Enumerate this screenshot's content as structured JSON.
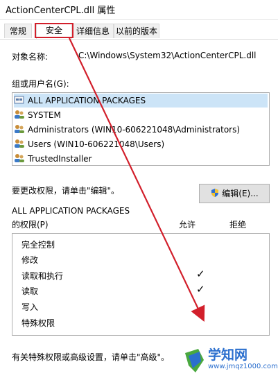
{
  "window": {
    "title": "ActionCenterCPL.dll 属性"
  },
  "tabs": [
    {
      "label": "常规"
    },
    {
      "label": "安全"
    },
    {
      "label": "详细信息"
    },
    {
      "label": "以前的版本"
    }
  ],
  "security": {
    "object_label": "对象名称:",
    "object_value": "C:\\Windows\\System32\\ActionCenterCPL.dll",
    "group_label": "组或用户名(G):",
    "users": [
      "ALL APPLICATION PACKAGES",
      "SYSTEM",
      "Administrators (WIN10-606221048\\Administrators)",
      "Users (WIN10-606221048\\Users)",
      "TrustedInstaller"
    ],
    "change_hint": "要更改权限，请单击\"编辑\"。",
    "edit_button": "编辑(E)...",
    "perm_for_line1": "ALL APPLICATION PACKAGES",
    "perm_for_line2": "的权限(P)",
    "allow_header": "允许",
    "deny_header": "拒绝",
    "permissions": [
      {
        "name": "完全控制",
        "allow": false
      },
      {
        "name": "修改",
        "allow": false
      },
      {
        "name": "读取和执行",
        "allow": true
      },
      {
        "name": "读取",
        "allow": true
      },
      {
        "name": "写入",
        "allow": false
      },
      {
        "name": "特殊权限",
        "allow": false
      }
    ],
    "check_mark": "✓",
    "advanced_hint": "有关特殊权限或高级设置，请单击\"高级\"。"
  },
  "watermark": {
    "text": "学知网",
    "url": "www.jmqz1000.com"
  },
  "colors": {
    "highlight": "#d21f2b",
    "selection": "#cce4f7",
    "watermark": "#2b6fce"
  }
}
